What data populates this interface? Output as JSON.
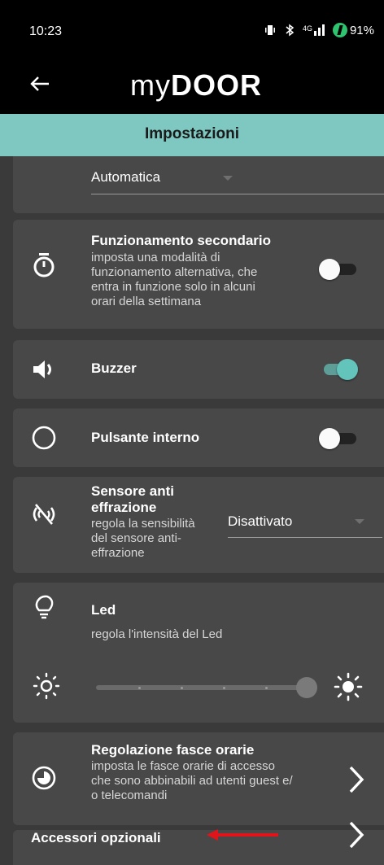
{
  "status_bar": {
    "time": "10:23",
    "network": "4G",
    "battery": "91%"
  },
  "app_bar": {
    "logo_my": "my",
    "logo_door": "DOOR"
  },
  "title": "Impostazioni",
  "mode_dropdown": {
    "value": "Automatica"
  },
  "secondary": {
    "title": "Funzionamento secondario",
    "desc_lines": [
      "imposta una modalità di",
      "funzionamento alternativa, che",
      "entra in funzione solo in alcuni",
      "orari della settimana"
    ],
    "toggle_on": false
  },
  "buzzer": {
    "title": "Buzzer",
    "toggle_on": true
  },
  "internal_button": {
    "title": "Pulsante interno",
    "toggle_on": false
  },
  "sensor": {
    "title_lines": [
      "Sensore anti",
      "effrazione"
    ],
    "desc_lines": [
      "regola la sensibilità",
      "del sensore anti-",
      "effrazione"
    ],
    "dropdown_value": "Disattivato"
  },
  "led": {
    "title": "Led",
    "desc": "regola l'intensità del Led",
    "level_fraction": 1.0
  },
  "time_slots": {
    "title": "Regolazione fasce orarie",
    "desc_lines": [
      "imposta le fasce orarie di accesso",
      "che sono abbinabili ad utenti guest e/",
      "o telecomandi"
    ]
  },
  "accessories": {
    "title": "Accessori opzionali"
  },
  "colors": {
    "accent": "#7ec8c1",
    "toggle_on": "#62c4bb",
    "arrow": "#e0141b"
  }
}
